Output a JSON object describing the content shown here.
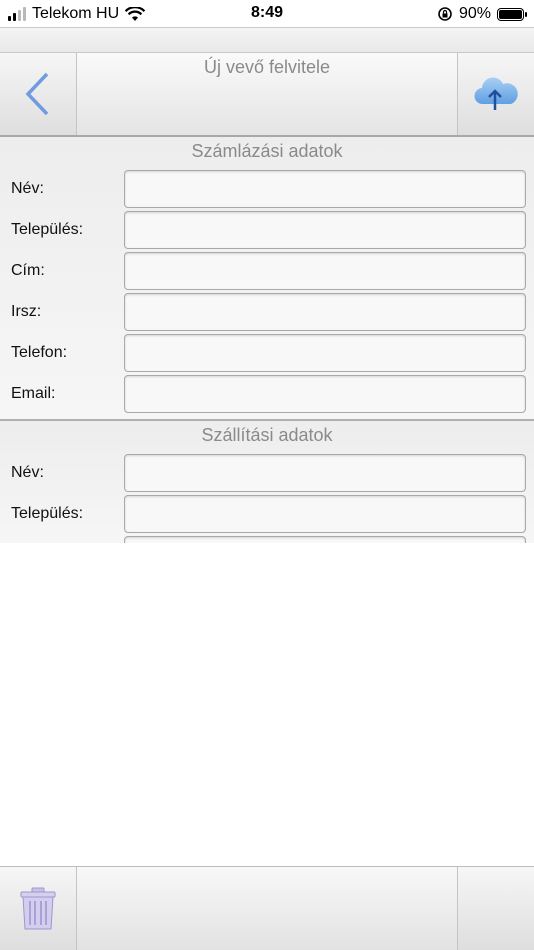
{
  "status_bar": {
    "carrier": "Telekom HU",
    "time": "8:49",
    "battery_percent_label": "90%",
    "battery_level": 0.9
  },
  "nav": {
    "title": "Új vevő felvitele",
    "back_icon": "chevron-left-icon",
    "upload_icon": "cloud-upload-icon"
  },
  "billing": {
    "title": "Számlázási adatok",
    "fields": [
      {
        "label": "Név:",
        "value": ""
      },
      {
        "label": "Település:",
        "value": ""
      },
      {
        "label": "Cím:",
        "value": ""
      },
      {
        "label": "Irsz:",
        "value": ""
      },
      {
        "label": "Telefon:",
        "value": ""
      },
      {
        "label": "Email:",
        "value": ""
      }
    ]
  },
  "shipping": {
    "title": "Szállítási adatok",
    "fields": [
      {
        "label": "Név:",
        "value": ""
      },
      {
        "label": "Település:",
        "value": ""
      }
    ]
  },
  "toolbar": {
    "delete_icon": "trash-icon"
  },
  "colors": {
    "accent_blue": "#5b8fd8",
    "trash_purple": "#c9c2e8"
  }
}
